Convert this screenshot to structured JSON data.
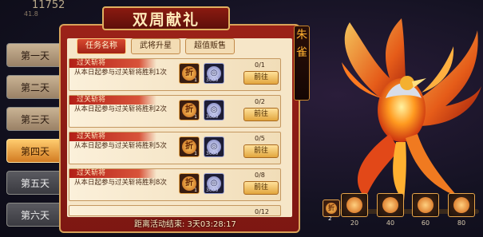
{
  "top": {
    "value": "11752",
    "sub": "41.8"
  },
  "title": "双周献礼",
  "days": [
    "第一天",
    "第二天",
    "第三天",
    "第四天",
    "第五天",
    "第六天"
  ],
  "active_day": 3,
  "subtabs": [
    {
      "label": "任务名称",
      "active": true
    },
    {
      "label": "武将升星",
      "active": false
    },
    {
      "label": "超值贩售",
      "active": false
    }
  ],
  "quests": [
    {
      "title": "过关斩将",
      "desc": "从本日起参与过关斩将胜利1次",
      "progress": "0/1",
      "reward1": "1",
      "reward2": "3000",
      "button": "前往"
    },
    {
      "title": "过关斩将",
      "desc": "从本日起参与过关斩将胜利2次",
      "progress": "0/2",
      "reward1": "1",
      "reward2": "3000",
      "button": "前往"
    },
    {
      "title": "过关斩将",
      "desc": "从本日起参与过关斩将胜利5次",
      "progress": "0/5",
      "reward1": "1",
      "reward2": "3000",
      "button": "前往"
    },
    {
      "title": "过关斩将",
      "desc": "从本日起参与过关斩将胜利8次",
      "progress": "0/8",
      "reward1": "1",
      "reward2": "3000",
      "button": "前往"
    },
    {
      "title": "",
      "desc": "",
      "progress": "0/12",
      "reward1": "",
      "reward2": "",
      "button": ""
    }
  ],
  "reward_icon": "折",
  "footer": "距离活动结束: 3天03:28:17",
  "hero_name": [
    "朱",
    "雀"
  ],
  "milestones": {
    "current": "2",
    "items": [
      "20",
      "40",
      "60",
      "80"
    ],
    "progress_fraction": 0.0
  },
  "colors": {
    "panel": "#8b1c14",
    "accent": "#e6a44a",
    "active_tab": "#f0a040"
  }
}
